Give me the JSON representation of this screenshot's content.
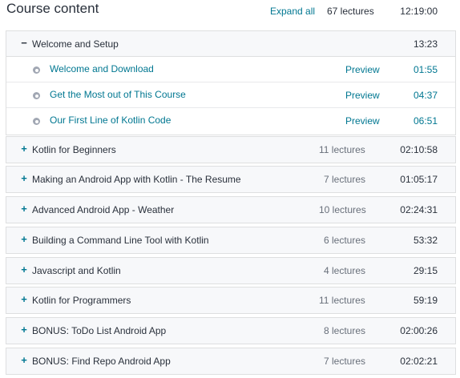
{
  "header": {
    "title": "Course content",
    "expand_all": "Expand all",
    "total_lectures": "67 lectures",
    "total_duration": "12:19:00"
  },
  "sections": [
    {
      "title": "Welcome and Setup",
      "toggle": "−",
      "count": "",
      "duration": "13:23",
      "lectures": [
        {
          "title": "Welcome and Download",
          "preview": "Preview",
          "duration": "01:55"
        },
        {
          "title": "Get the Most out of This Course",
          "preview": "Preview",
          "duration": "04:37"
        },
        {
          "title": "Our First Line of Kotlin Code",
          "preview": "Preview",
          "duration": "06:51"
        }
      ]
    },
    {
      "title": "Kotlin for Beginners",
      "toggle": "+",
      "count": "11 lectures",
      "duration": "02:10:58"
    },
    {
      "title": "Making an Android App with Kotlin - The Resume",
      "toggle": "+",
      "count": "7 lectures",
      "duration": "01:05:17"
    },
    {
      "title": "Advanced Android App - Weather",
      "toggle": "+",
      "count": "10 lectures",
      "duration": "02:24:31"
    },
    {
      "title": "Building a Command Line Tool with Kotlin",
      "toggle": "+",
      "count": "6 lectures",
      "duration": "53:32"
    },
    {
      "title": "Javascript and Kotlin",
      "toggle": "+",
      "count": "4 lectures",
      "duration": "29:15"
    },
    {
      "title": "Kotlin for Programmers",
      "toggle": "+",
      "count": "11 lectures",
      "duration": "59:19"
    },
    {
      "title": "BONUS: ToDo List Android App",
      "toggle": "+",
      "count": "8 lectures",
      "duration": "02:00:26"
    },
    {
      "title": "BONUS: Find Repo Android App",
      "toggle": "+",
      "count": "7 lectures",
      "duration": "02:02:21"
    }
  ]
}
